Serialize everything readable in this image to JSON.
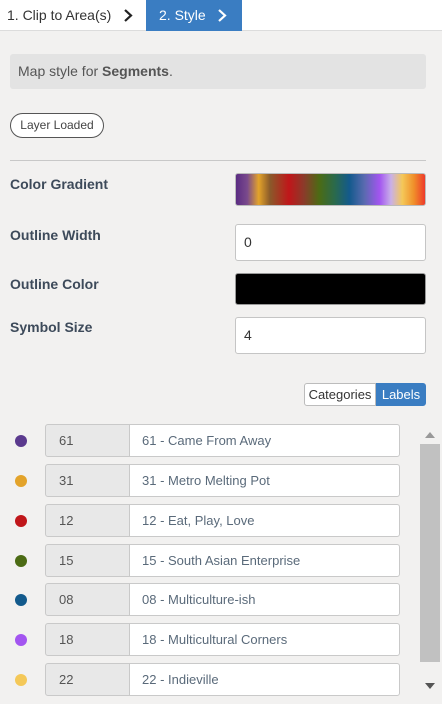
{
  "steps": [
    {
      "label": "1. Clip to Area(s)",
      "icon": "chevron-right-icon",
      "active": false
    },
    {
      "label": "2. Style",
      "icon": "chevron-right-icon",
      "active": true
    }
  ],
  "info": {
    "prefix": "Map style for ",
    "layer": "Segments",
    "suffix": "."
  },
  "status_pill": "Layer Loaded",
  "properties": {
    "color_gradient_label": "Color Gradient",
    "outline_width_label": "Outline Width",
    "outline_width_value": "0",
    "outline_color_label": "Outline Color",
    "outline_color_value": "#000000",
    "symbol_size_label": "Symbol Size",
    "symbol_size_value": "4"
  },
  "toggle": {
    "categories": "Categories",
    "labels": "Labels",
    "selected": "Labels"
  },
  "segments": [
    {
      "code": "61",
      "label": "61 - Came From Away",
      "color": "#5b3a8e"
    },
    {
      "code": "31",
      "label": "31 - Metro Melting Pot",
      "color": "#e3a32a"
    },
    {
      "code": "12",
      "label": "12 - Eat, Play, Love",
      "color": "#c0161a"
    },
    {
      "code": "15",
      "label": "15 - South Asian Enterprise",
      "color": "#4c6b14"
    },
    {
      "code": "08",
      "label": "08 - Multiculture-ish",
      "color": "#135a8c"
    },
    {
      "code": "18",
      "label": "18 - Multicultural Corners",
      "color": "#a355f0"
    },
    {
      "code": "22",
      "label": "22 - Indieville",
      "color": "#f4c858"
    }
  ],
  "colors": {
    "accent": "#3a7dc2"
  }
}
